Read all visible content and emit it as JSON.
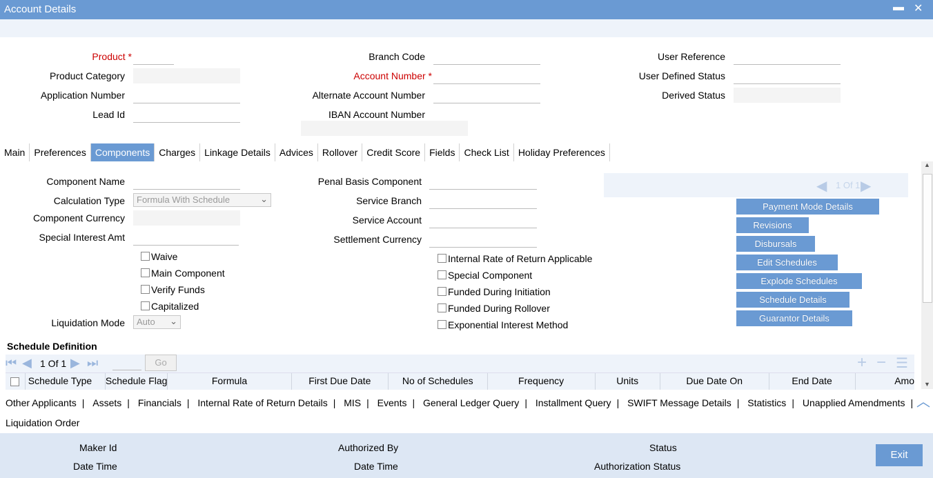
{
  "window": {
    "title": "Account Details",
    "minimize_glyph": "▬",
    "close_glyph": "✕"
  },
  "header": {
    "product_label": "Product",
    "product_category_label": "Product Category",
    "application_number_label": "Application Number",
    "lead_id_label": "Lead Id",
    "branch_code_label": "Branch Code",
    "account_number_label": "Account Number",
    "alternate_account_number_label": "Alternate Account Number",
    "iban_account_number_label": "IBAN Account Number",
    "user_reference_label": "User Reference",
    "user_defined_status_label": "User Defined Status",
    "derived_status_label": "Derived Status",
    "required_mark": "*"
  },
  "tabs": [
    {
      "label": "Main"
    },
    {
      "label": "Preferences"
    },
    {
      "label": "Components"
    },
    {
      "label": "Charges"
    },
    {
      "label": "Linkage Details"
    },
    {
      "label": "Advices"
    },
    {
      "label": "Rollover"
    },
    {
      "label": "Credit Score"
    },
    {
      "label": "Fields"
    },
    {
      "label": "Check List"
    },
    {
      "label": "Holiday Preferences"
    }
  ],
  "active_tab": "Components",
  "components": {
    "component_name_label": "Component Name",
    "calculation_type_label": "Calculation Type",
    "calculation_type_value": "Formula With Schedule",
    "component_currency_label": "Component Currency",
    "special_interest_amt_label": "Special Interest Amt",
    "waive_label": "Waive",
    "main_component_label": "Main Component",
    "verify_funds_label": "Verify Funds",
    "capitalized_label": "Capitalized",
    "liquidation_mode_label": "Liquidation Mode",
    "liquidation_mode_value": "Auto",
    "penal_basis_component_label": "Penal Basis Component",
    "service_branch_label": "Service Branch",
    "service_account_label": "Service Account",
    "settlement_currency_label": "Settlement Currency",
    "irr_applicable_label": "Internal Rate of Return Applicable",
    "special_component_label": "Special Component",
    "funded_during_initiation_label": "Funded During Initiation",
    "funded_during_rollover_label": "Funded During Rollover",
    "exponential_interest_label": "Exponential Interest Method"
  },
  "navigator": {
    "page_text": "1 Of 1"
  },
  "side_buttons": [
    {
      "label": "Payment Mode Details"
    },
    {
      "label": "Revisions"
    },
    {
      "label": "Disbursals"
    },
    {
      "label": "Edit Schedules"
    },
    {
      "label": "Explode Schedules"
    },
    {
      "label": "Schedule Details"
    },
    {
      "label": "Guarantor Details"
    }
  ],
  "schedule": {
    "section_title": "Schedule Definition",
    "page_text": "1 Of 1",
    "go_label": "Go",
    "columns": [
      "Schedule Type",
      "Schedule Flag",
      "Formula",
      "First Due Date",
      "No of Schedules",
      "Frequency",
      "Units",
      "Due Date On",
      "End Date",
      "Amo"
    ]
  },
  "bottom_links": [
    "Other Applicants",
    "Assets",
    "Financials",
    "Internal Rate of Return Details",
    "MIS",
    "Events",
    "General Ledger Query",
    "Installment Query",
    "SWIFT Message Details",
    "Statistics",
    "Unapplied Amendments",
    "Liquidation Order"
  ],
  "bottom_separator": "|",
  "footer": {
    "maker_id_label": "Maker Id",
    "date_time_label_1": "Date Time",
    "authorized_by_label": "Authorized By",
    "date_time_label_2": "Date Time",
    "status_label": "Status",
    "authorization_status_label": "Authorization Status",
    "exit_label": "Exit"
  },
  "colors": {
    "accent": "#6a9ad3",
    "required": "#cc0000",
    "panel_light": "#eef3fa",
    "footer_bg": "#dde7f4"
  }
}
